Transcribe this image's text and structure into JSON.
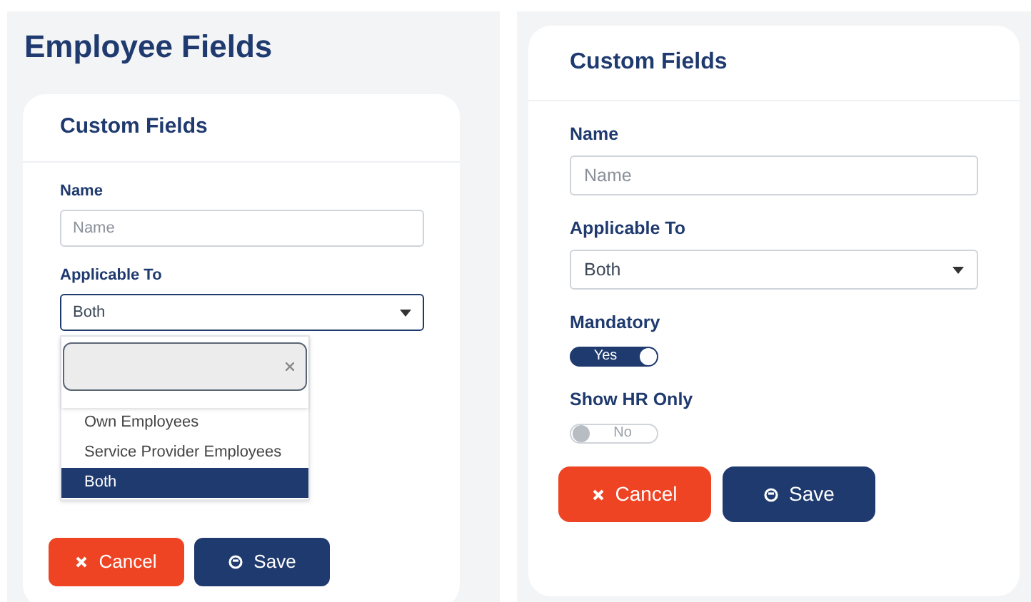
{
  "screens": [
    {
      "page_title": "Employee Fields",
      "card": {
        "title": "Custom Fields",
        "fields": [
          {
            "kind": "text",
            "label": "Name",
            "placeholder": "Name"
          },
          {
            "kind": "select",
            "label": "Applicable To",
            "value": "Both",
            "focused": true,
            "options": [
              {
                "label": "Own Employees",
                "selected": false
              },
              {
                "label": "Service Provider Employees",
                "selected": false
              },
              {
                "label": "Both",
                "selected": true
              }
            ]
          }
        ],
        "buttons": [
          {
            "kind": "cancel",
            "label": "Cancel"
          },
          {
            "kind": "save",
            "label": "Save"
          }
        ]
      }
    },
    {
      "card": {
        "title": "Custom Fields",
        "fields": [
          {
            "kind": "text",
            "label": "Name",
            "placeholder": "Name"
          },
          {
            "kind": "select",
            "label": "Applicable To",
            "value": "Both",
            "focused": false
          },
          {
            "kind": "toggle",
            "label": "Mandatory",
            "on": true,
            "text": "Yes"
          },
          {
            "kind": "toggle",
            "label": "Show HR Only",
            "on": false,
            "text": "No"
          }
        ],
        "buttons": [
          {
            "kind": "cancel",
            "label": "Cancel"
          },
          {
            "kind": "save",
            "label": "Save"
          }
        ]
      }
    }
  ]
}
